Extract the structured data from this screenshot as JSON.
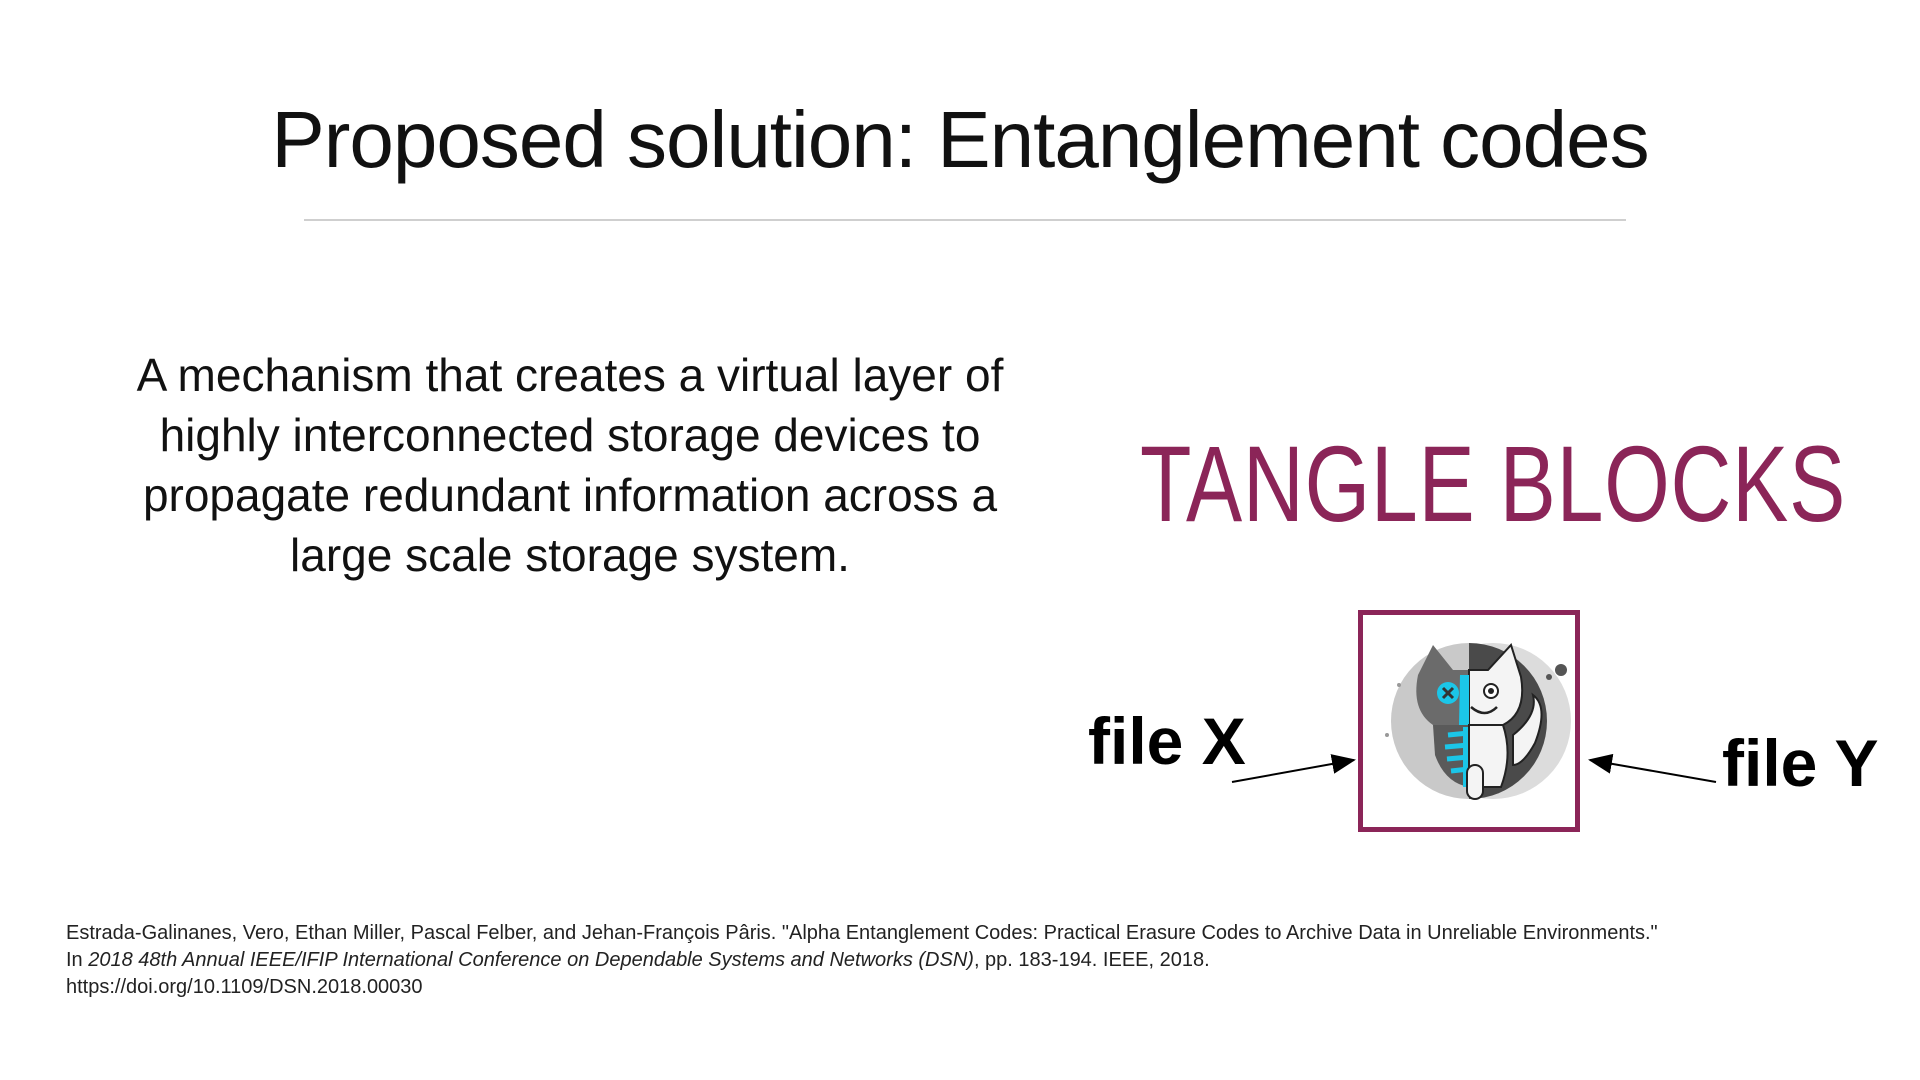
{
  "slide": {
    "title": "Proposed solution: Entanglement codes",
    "description": "A mechanism that creates a virtual layer of highly interconnected storage devices to propagate redundant information across a large scale storage system.",
    "brand_text": "TANGLE BLOCKS",
    "file_left_label": "file X",
    "file_right_label": "file Y",
    "logo_icon": "cat-xray-logo-icon",
    "accent_color": "#8b2558"
  },
  "citation": {
    "line1": "Estrada-Galinanes, Vero, Ethan Miller, Pascal Felber, and Jehan-François Pâris. \"Alpha Entanglement Codes: Practical Erasure Codes to Archive Data in Unreliable Environments.\"",
    "line2_prefix": "In ",
    "line2_italic": "2018 48th Annual IEEE/IFIP International Conference on Dependable Systems and Networks (DSN)",
    "line2_suffix": ", pp. 183-194. IEEE, 2018.",
    "line3": "https://doi.org/10.1109/DSN.2018.00030"
  }
}
